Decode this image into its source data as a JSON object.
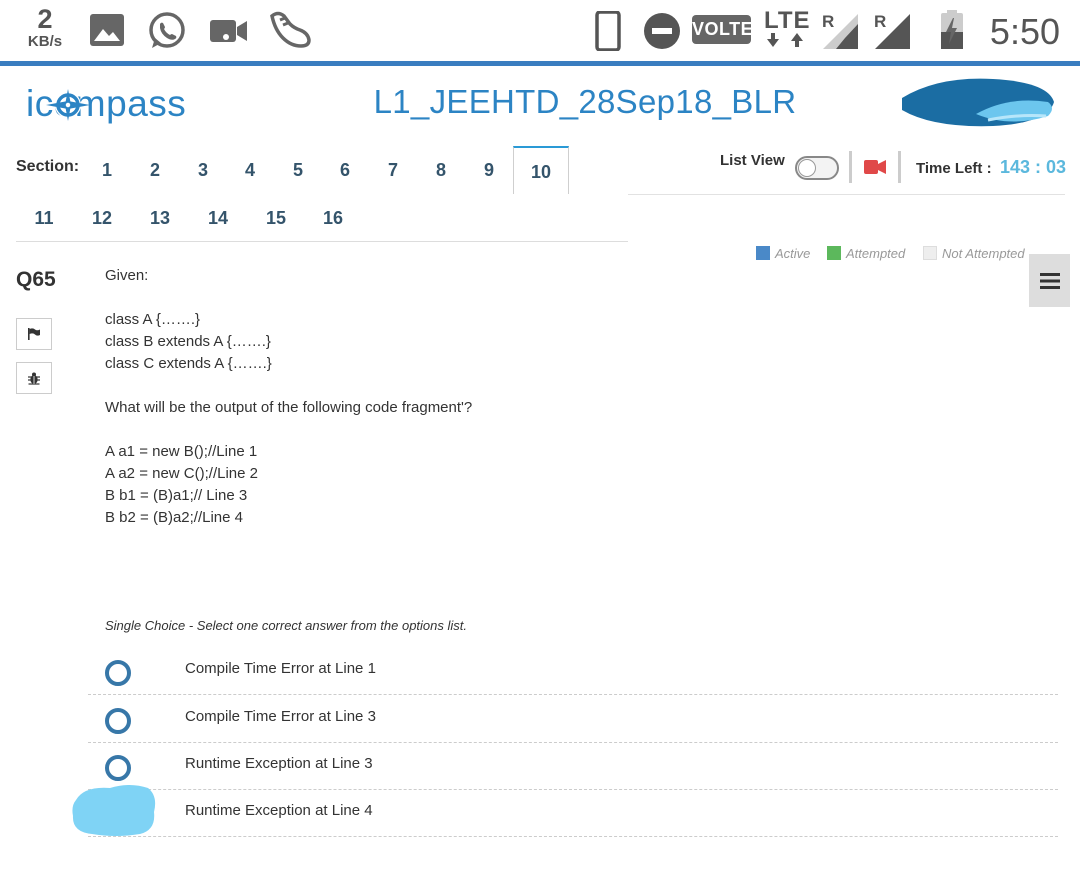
{
  "status_bar": {
    "speed_value": "2",
    "speed_unit": "KB/s",
    "icons": [
      "gallery-icon",
      "whatsapp-icon",
      "video-call-icon",
      "sneaker-icon",
      "phone-icon",
      "do-not-disturb-icon",
      "lte-icon",
      "signal-icon",
      "signal-icon",
      "battery-charging-icon"
    ],
    "volte": "VOLTE",
    "lte": "LTE",
    "roaming_1": "R",
    "roaming_2": "R",
    "time": "5:50"
  },
  "header": {
    "logo_text": "icompass",
    "test_title": "L1_JEEHTD_28Sep18_BLR"
  },
  "sections": {
    "label": "Section:",
    "items": [
      "1",
      "2",
      "3",
      "4",
      "5",
      "6",
      "7",
      "8",
      "9",
      "10",
      "11",
      "12",
      "13",
      "14",
      "15",
      "16"
    ],
    "active": "10"
  },
  "toolbar": {
    "list_view_label": "List View",
    "list_view_on": false,
    "time_left_label": "Time Left :",
    "time_left_value": "143 : 03"
  },
  "legend": {
    "active": "Active",
    "attempted": "Attempted",
    "not_attempted": "Not Attempted",
    "colors": {
      "active": "#4a89c8",
      "attempted": "#5cb85c",
      "not_attempted": "#eeeeee"
    }
  },
  "question": {
    "number": "Q65",
    "lines": [
      "Given:",
      "",
      "class A {…….}",
      "class B extends A {…….}",
      "class C extends A {…….}",
      "",
      "What will be the output of the following code fragment'?",
      "",
      "A a1 = new B();//Line 1",
      "A a2 = new C();//Line 2",
      "B b1 = (B)a1;// Line 3",
      "B b2 = (B)a2;//Line 4"
    ],
    "type_hint": "Single Choice - Select one correct answer from the options list.",
    "options": [
      "Compile Time Error at Line 1",
      "Compile Time Error at Line 3",
      "Runtime Exception at Line 3",
      "Runtime Exception at Line 4"
    ]
  },
  "colors": {
    "accent": "#2c84c4",
    "timer": "#5bb8dd",
    "radio": "#3777a8",
    "scribble": "#7fd3f5"
  }
}
